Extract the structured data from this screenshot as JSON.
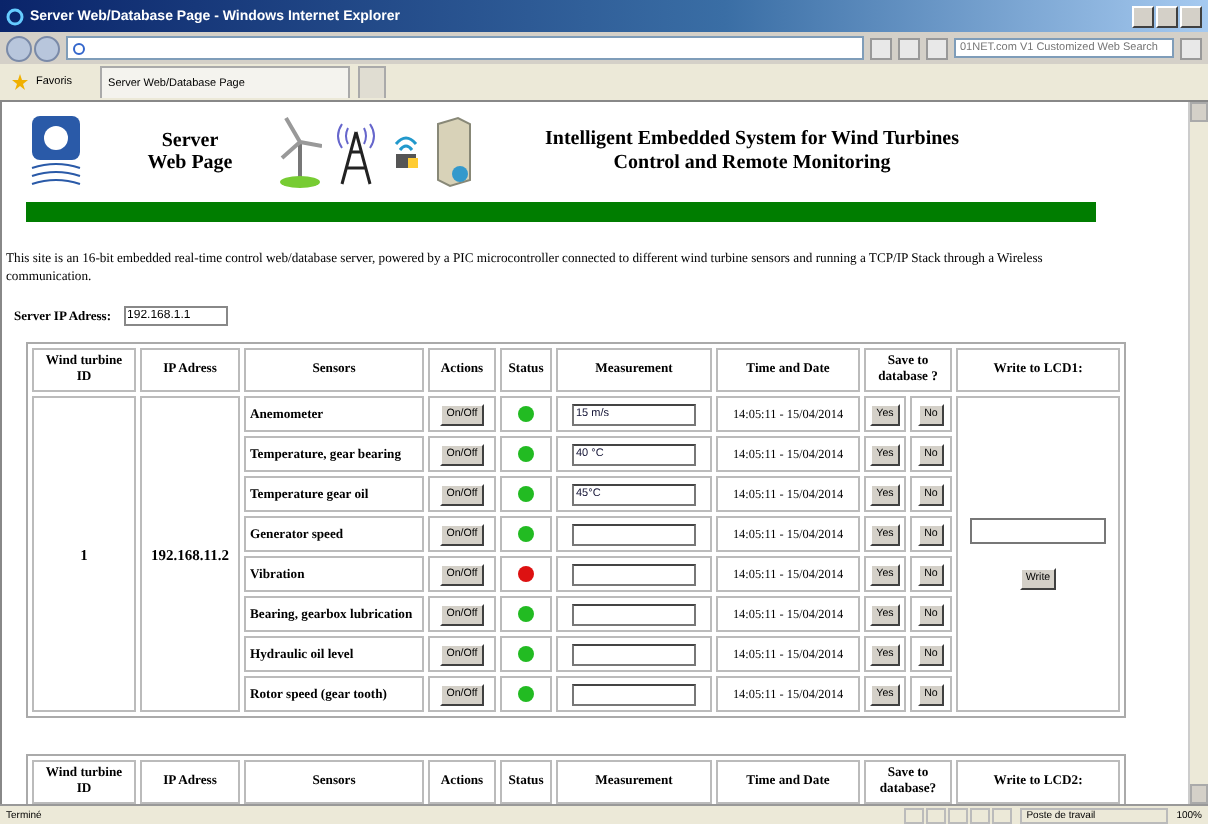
{
  "window": {
    "title": "Server Web/Database Page - Windows Internet Explorer"
  },
  "toolbar": {
    "search_placeholder": "01NET.com V1 Customized Web Search"
  },
  "favorites_bar": {
    "favorites": "Favoris",
    "tab": "Server Web/Database Page"
  },
  "page": {
    "header": {
      "subtitle": "Server Web Page",
      "title": "Intelligent Embedded System for Wind Turbines Control and Remote Monitoring"
    },
    "intro": "This site is an 16-bit embedded real-time control web/database server, powered by a PIC microcontroller connected to different wind turbine sensors and running a TCP/IP Stack through a Wireless communication.",
    "server_ip": {
      "label": "Server IP Adress:",
      "value": "192.168.1.1"
    },
    "tables": [
      {
        "columns": [
          "Wind turbine ID",
          "IP Adress",
          "Sensors",
          "Actions",
          "Status",
          "Measurement",
          "Time and Date",
          "Save to database ?",
          "Write to LCD1:"
        ],
        "turbine_id": "1",
        "ip": "192.168.11.2",
        "write_button": "Write",
        "rows": [
          {
            "sensor": "Anemometer",
            "action": "On/Off",
            "color": "#22bb22",
            "measurement": "15 m/s",
            "time": "14:05:11 - 15/04/2014",
            "yes": "Yes",
            "no": "No"
          },
          {
            "sensor": "Temperature, gear bearing",
            "action": "On/Off",
            "color": "#22bb22",
            "measurement": "40 °C",
            "time": "14:05:11 - 15/04/2014",
            "yes": "Yes",
            "no": "No"
          },
          {
            "sensor": "Temperature gear oil",
            "action": "On/Off",
            "color": "#22bb22",
            "measurement": "45°C",
            "time": "14:05:11 - 15/04/2014",
            "yes": "Yes",
            "no": "No"
          },
          {
            "sensor": "Generator speed",
            "action": "On/Off",
            "color": "#22bb22",
            "time": "14:05:11 - 15/04/2014",
            "yes": "Yes",
            "no": "No"
          },
          {
            "sensor": "Vibration",
            "action": "On/Off",
            "color": "#dd1111",
            "time": "14:05:11 - 15/04/2014",
            "yes": "Yes",
            "no": "No"
          },
          {
            "sensor": "Bearing, gearbox lubrication",
            "action": "On/Off",
            "color": "#22bb22",
            "time": "14:05:11 - 15/04/2014",
            "yes": "Yes",
            "no": "No"
          },
          {
            "sensor": "Hydraulic oil level",
            "action": "On/Off",
            "color": "#22bb22",
            "time": "14:05:11 - 15/04/2014",
            "yes": "Yes",
            "no": "No"
          },
          {
            "sensor": "Rotor speed (gear tooth)",
            "action": "On/Off",
            "color": "#22bb22",
            "time": "14:05:11 - 15/04/2014",
            "yes": "Yes",
            "no": "No"
          }
        ]
      },
      {
        "columns": [
          "Wind turbine ID",
          "IP Adress",
          "Sensors",
          "Actions",
          "Status",
          "Measurement",
          "Time and Date",
          "Save to database?",
          "Write to LCD2:"
        ]
      }
    ]
  },
  "status_bar": {
    "status": "Terminé",
    "zone": "Poste de travail",
    "zoom": "100%"
  }
}
